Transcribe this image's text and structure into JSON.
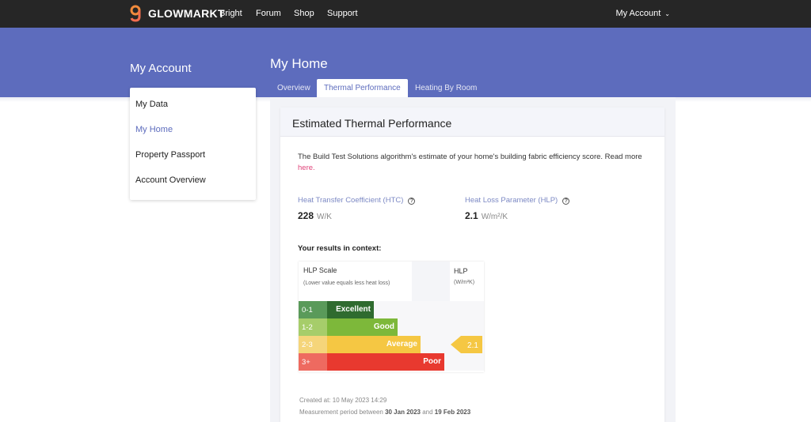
{
  "brand": {
    "name": "GLOWMARKT",
    "logo_color": "#f28b3c"
  },
  "nav": [
    {
      "label": "Bright"
    },
    {
      "label": "Forum"
    },
    {
      "label": "Shop"
    },
    {
      "label": "Support"
    }
  ],
  "account_menu": {
    "label": "My Account",
    "icon": "chevron-down-icon"
  },
  "colors": {
    "header": "#262626",
    "accent": "#5d6cbd",
    "link": "#e0447a"
  },
  "sidebar": {
    "title": "My Account",
    "items": [
      {
        "label": "My Data"
      },
      {
        "label": "My Home",
        "active": true
      },
      {
        "label": "Property Passport"
      },
      {
        "label": "Account Overview"
      }
    ]
  },
  "page": {
    "title": "My Home",
    "tabs": [
      {
        "label": "Overview"
      },
      {
        "label": "Thermal Performance",
        "active": true
      },
      {
        "label": "Heating By Room"
      }
    ]
  },
  "card": {
    "title": "Estimated Thermal Performance",
    "description": "The Build Test Solutions algorithm's estimate of your home's building fabric efficiency score. Read more ",
    "link_text": "here.",
    "metrics": [
      {
        "label": "Heat Transfer Coefficient (HTC)",
        "value": "228",
        "unit": "W/K",
        "icon": "question-circle-icon"
      },
      {
        "label": "Heat Loss Parameter (HLP)",
        "value": "2.1",
        "unit": "W/m²/K",
        "icon": "question-circle-icon"
      }
    ],
    "context_label": "Your results in context:",
    "scale": {
      "title": "HLP Scale",
      "subtitle": "(Lower value equals less heat loss)",
      "column_title": "HLP",
      "column_unit": "(W/m²K)",
      "bands": [
        {
          "range": "0-1",
          "label": "Excellent",
          "range_color": "#5a9a5a",
          "bar_color": "#2f6b2f"
        },
        {
          "range": "1-2",
          "label": "Good",
          "range_color": "#a6cd6a",
          "bar_color": "#7db83a"
        },
        {
          "range": "2-3",
          "label": "Average",
          "range_color": "#f5d57a",
          "bar_color": "#f5c743"
        },
        {
          "range": "3+",
          "label": "Poor",
          "range_color": "#ee6a60",
          "bar_color": "#e8392f"
        }
      ],
      "marker": {
        "value": "2.1",
        "band": "2-3",
        "color": "#f5c743"
      }
    },
    "created": "Created at: 10 May 2023 14:29",
    "period_prefix": "Measurement period between ",
    "period_start": "30 Jan 2023",
    "period_and": " and ",
    "period_end": "19 Feb 2023"
  }
}
